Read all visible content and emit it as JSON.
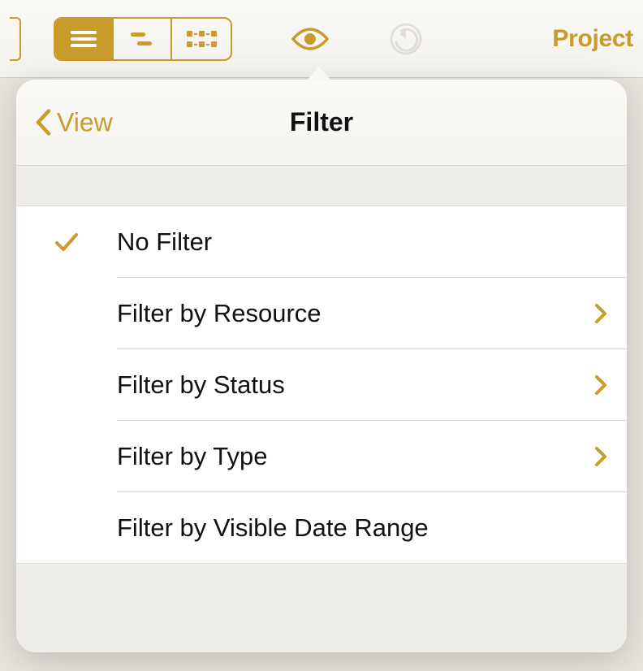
{
  "colors": {
    "accent": "#c89b2a",
    "disabled": "#c9c6be"
  },
  "toolbar": {
    "project_label": "Project"
  },
  "popover": {
    "back_label": "View",
    "title": "Filter",
    "items": [
      {
        "label": "No Filter",
        "selected": true,
        "has_disclosure": false
      },
      {
        "label": "Filter by Resource",
        "selected": false,
        "has_disclosure": true
      },
      {
        "label": "Filter by Status",
        "selected": false,
        "has_disclosure": true
      },
      {
        "label": "Filter by Type",
        "selected": false,
        "has_disclosure": true
      },
      {
        "label": "Filter by Visible Date Range",
        "selected": false,
        "has_disclosure": false
      }
    ]
  }
}
